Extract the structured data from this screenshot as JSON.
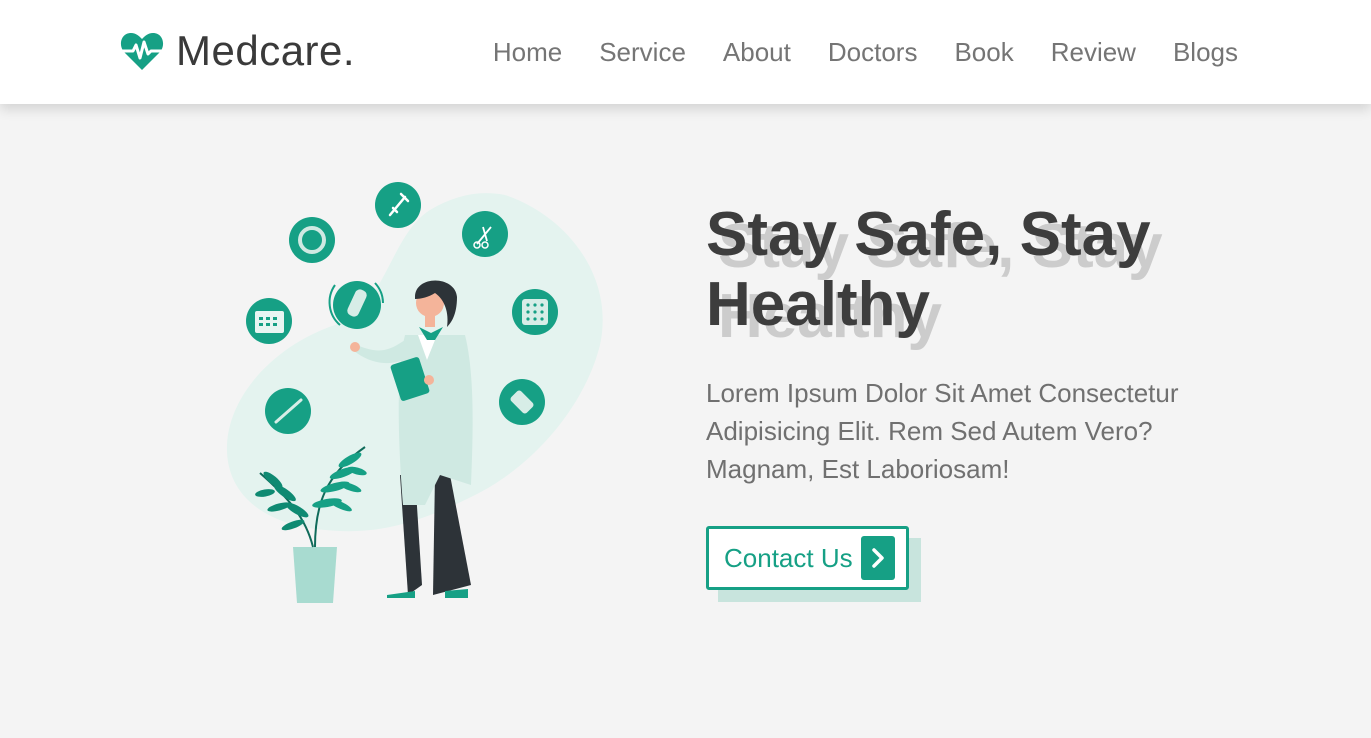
{
  "brand": {
    "name": "Medcare.",
    "icon": "heartbeat-icon",
    "color": "#16a085"
  },
  "nav": {
    "items": [
      {
        "label": "Home"
      },
      {
        "label": "Service"
      },
      {
        "label": "About"
      },
      {
        "label": "Doctors"
      },
      {
        "label": "Book"
      },
      {
        "label": "Review"
      },
      {
        "label": "Blogs"
      }
    ]
  },
  "hero": {
    "title": "Stay Safe, Stay\nHealthy",
    "description": "Lorem Ipsum Dolor Sit Amet Consectetur Adipisicing Elit. Rem Sed Autem Vero? Magnam, Est Laboriosam!",
    "cta_label": "Contact Us",
    "cta_icon": "chevron-right-icon"
  },
  "colors": {
    "accent": "#16a085",
    "accent_light": "#c8e4dd",
    "background": "#f4f4f4",
    "text_dark": "#3d3d3d",
    "text_muted": "#707070"
  }
}
